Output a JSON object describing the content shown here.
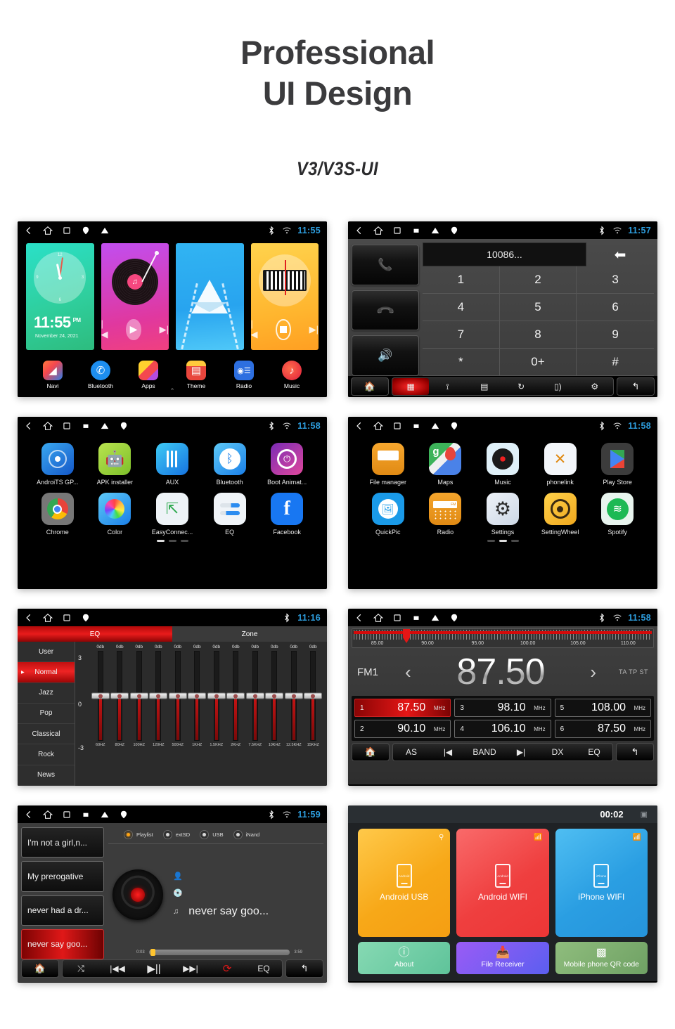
{
  "header": {
    "title_line1": "Professional",
    "title_line2": "UI Design",
    "subtitle": "V3/V3S-UI"
  },
  "screens": {
    "home": {
      "statusbar": {
        "time": "11:55",
        "icons": [
          "back-icon",
          "home-icon",
          "recents-icon",
          "location-icon",
          "warning-icon"
        ],
        "right_icons": [
          "bluetooth-icon",
          "wifi-icon"
        ]
      },
      "clock_widget": {
        "time": "11:55",
        "ampm": "PM",
        "date": "November 24, 2021"
      },
      "widgets": [
        "clock",
        "music",
        "navigation",
        "radio"
      ],
      "dock": [
        {
          "label": "Navi",
          "icon": "navi-icon"
        },
        {
          "label": "Bluetooth",
          "icon": "bluetooth-icon"
        },
        {
          "label": "Apps",
          "icon": "apps-icon"
        },
        {
          "label": "Theme",
          "icon": "theme-icon"
        },
        {
          "label": "Radio",
          "icon": "radio-icon"
        },
        {
          "label": "Music",
          "icon": "music-icon"
        }
      ]
    },
    "phone": {
      "statusbar": {
        "time": "11:57"
      },
      "display_value": "10086...",
      "side_buttons": [
        "call-answer-button",
        "call-end-button",
        "mute-speaker-button"
      ],
      "keys": [
        "1",
        "2",
        "3",
        "4",
        "5",
        "6",
        "7",
        "8",
        "9",
        "*",
        "0+",
        "#"
      ],
      "nav": [
        {
          "icon": "home-icon",
          "active": false
        },
        {
          "icon": "keypad-icon",
          "active": true
        },
        {
          "icon": "call-log-icon",
          "active": false
        },
        {
          "icon": "contacts-icon",
          "active": false
        },
        {
          "icon": "call-history-icon",
          "active": false
        },
        {
          "icon": "phone-sync-icon",
          "active": false
        },
        {
          "icon": "gear-icon",
          "active": false
        },
        {
          "icon": "back-icon",
          "active": false
        }
      ]
    },
    "apps1": {
      "statusbar": {
        "time": "11:58"
      },
      "apps": [
        {
          "label": "AndroiTS GP...",
          "icon": "gps-icon"
        },
        {
          "label": "APK installer",
          "icon": "android-icon"
        },
        {
          "label": "AUX",
          "icon": "aux-icon"
        },
        {
          "label": "Bluetooth",
          "icon": "bluetooth-icon"
        },
        {
          "label": "Boot Animat...",
          "icon": "power-icon"
        },
        {
          "label": "Chrome",
          "icon": "chrome-icon"
        },
        {
          "label": "Color",
          "icon": "color-icon"
        },
        {
          "label": "EasyConnec...",
          "icon": "easyconnect-icon"
        },
        {
          "label": "EQ",
          "icon": "eq-icon"
        },
        {
          "label": "Facebook",
          "icon": "facebook-icon"
        }
      ],
      "page_index": 0,
      "page_count": 3
    },
    "apps2": {
      "statusbar": {
        "time": "11:58"
      },
      "apps": [
        {
          "label": "File manager",
          "icon": "folder-icon"
        },
        {
          "label": "Maps",
          "icon": "maps-icon"
        },
        {
          "label": "Music",
          "icon": "vinyl-icon"
        },
        {
          "label": "phonelink",
          "icon": "phonelink-icon"
        },
        {
          "label": "Play Store",
          "icon": "playstore-icon"
        },
        {
          "label": "QuickPic",
          "icon": "gallery-icon"
        },
        {
          "label": "Radio",
          "icon": "radio-icon"
        },
        {
          "label": "Settings",
          "icon": "gear-icon"
        },
        {
          "label": "SettingWheel",
          "icon": "steering-wheel-icon"
        },
        {
          "label": "Spotify",
          "icon": "spotify-icon"
        }
      ],
      "page_index": 1,
      "page_count": 3
    },
    "eq": {
      "statusbar": {
        "time": "11:16"
      },
      "tabs": [
        {
          "label": "EQ",
          "active": true
        },
        {
          "label": "Zone",
          "active": false
        }
      ],
      "presets": [
        {
          "label": "User",
          "active": false
        },
        {
          "label": "Normal",
          "active": true
        },
        {
          "label": "Jazz",
          "active": false
        },
        {
          "label": "Pop",
          "active": false
        },
        {
          "label": "Classical",
          "active": false
        },
        {
          "label": "Rock",
          "active": false
        },
        {
          "label": "News",
          "active": false
        }
      ],
      "scale": {
        "top": "3",
        "mid": "0",
        "bottom": "-3"
      },
      "bands": [
        {
          "freq": "60HZ",
          "value": "0db"
        },
        {
          "freq": "80HZ",
          "value": "0db"
        },
        {
          "freq": "100HZ",
          "value": "0db"
        },
        {
          "freq": "120HZ",
          "value": "0db"
        },
        {
          "freq": "500HZ",
          "value": "0db"
        },
        {
          "freq": "1KHZ",
          "value": "0db"
        },
        {
          "freq": "1.5KHZ",
          "value": "0db"
        },
        {
          "freq": "2KHZ",
          "value": "0db"
        },
        {
          "freq": "7.5KHZ",
          "value": "0db"
        },
        {
          "freq": "10KHZ",
          "value": "0db"
        },
        {
          "freq": "12.5KHZ",
          "value": "0db"
        },
        {
          "freq": "15KHZ",
          "value": "0db"
        }
      ]
    },
    "radio": {
      "statusbar": {
        "time": "11:58"
      },
      "scale_labels": [
        "85.00",
        "90.00",
        "95.00",
        "100.00",
        "105.00",
        "110.00"
      ],
      "band": "FM1",
      "frequency": "87.50",
      "rds": "TA TP ST",
      "presets": [
        {
          "num": "1",
          "freq": "87.50",
          "unit": "MHz",
          "active": true
        },
        {
          "num": "2",
          "freq": "90.10",
          "unit": "MHz",
          "active": false
        },
        {
          "num": "3",
          "freq": "98.10",
          "unit": "MHz",
          "active": false
        },
        {
          "num": "4",
          "freq": "106.10",
          "unit": "MHz",
          "active": false
        },
        {
          "num": "5",
          "freq": "108.00",
          "unit": "MHz",
          "active": false
        },
        {
          "num": "6",
          "freq": "87.50",
          "unit": "MHz",
          "active": false
        }
      ],
      "nav": [
        "AS",
        "prev-icon",
        "BAND",
        "next-icon",
        "DX",
        "EQ"
      ]
    },
    "music": {
      "statusbar": {
        "time": "11:59"
      },
      "playlist": [
        {
          "title": "I'm not a girl,n...",
          "active": false
        },
        {
          "title": "My prerogative",
          "active": false
        },
        {
          "title": "never had a dr...",
          "active": false
        },
        {
          "title": "never say goo...",
          "active": true
        }
      ],
      "sources": [
        {
          "label": "Playlist",
          "selected": true
        },
        {
          "label": "extSD",
          "selected": false
        },
        {
          "label": "USB",
          "selected": false
        },
        {
          "label": "iNand",
          "selected": false
        }
      ],
      "now_playing": {
        "artist": "",
        "album": "",
        "title": "never say goo..."
      },
      "progress": {
        "elapsed": "0:03",
        "total": "3:59"
      },
      "nav": [
        "home-icon",
        "shuffle-icon",
        "prev-icon",
        "play-pause-icon",
        "next-icon",
        "repeat-icon",
        "EQ",
        "back-icon"
      ]
    },
    "phonelink": {
      "time": "00:02",
      "tiles": [
        {
          "label": "Android USB",
          "device": "Android",
          "corner_icon": "usb-icon",
          "color": "#fbb216"
        },
        {
          "label": "Android WIFI",
          "device": "Android",
          "corner_icon": "wifi-icon",
          "color": "#f14f4f"
        },
        {
          "label": "iPhone WIFI",
          "device": "iPhone",
          "corner_icon": "wifi-icon",
          "color": "#32a7e8"
        }
      ],
      "small_tiles": [
        {
          "label": "About",
          "icon": "info-icon",
          "color": "#74cfa8"
        },
        {
          "label": "File Receiver",
          "icon": "download-icon",
          "color": "#7a5cf0"
        },
        {
          "label": "Mobile phone QR code",
          "icon": "qr-icon",
          "color": "#7fae72"
        }
      ]
    }
  },
  "colors": {
    "accent_red": "#e01818",
    "status_time_blue": "#2e9fe0",
    "background": "#ffffff"
  }
}
